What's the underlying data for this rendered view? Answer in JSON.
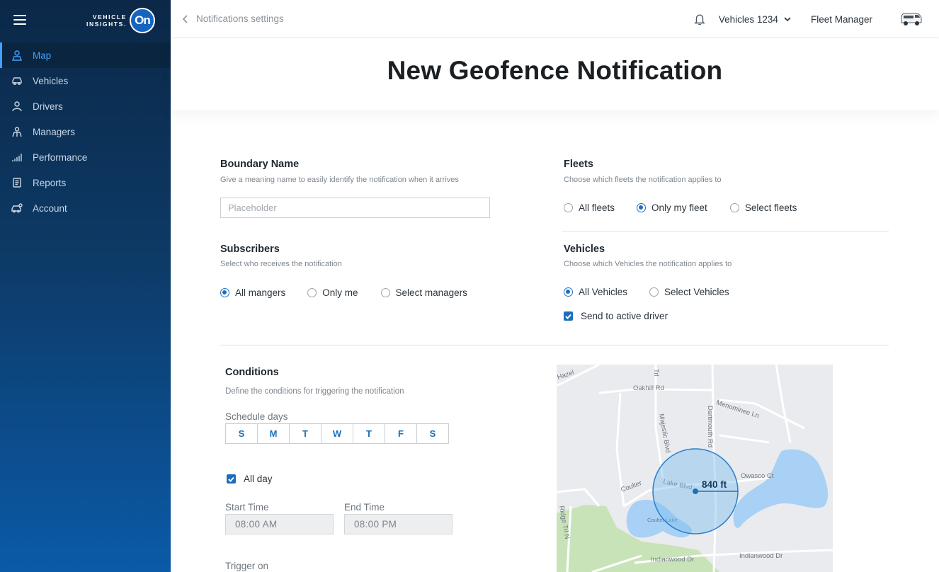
{
  "app": {
    "brand_line1": "VEHICLE",
    "brand_line2": "INSIGHTS.",
    "brand_mark": "On"
  },
  "sidebar": {
    "items": [
      {
        "label": "Map",
        "icon": "map-pin-user-icon",
        "active": true
      },
      {
        "label": "Vehicles",
        "icon": "car-icon",
        "active": false
      },
      {
        "label": "Drivers",
        "icon": "driver-icon",
        "active": false
      },
      {
        "label": "Managers",
        "icon": "managers-icon",
        "active": false
      },
      {
        "label": "Performance",
        "icon": "bar-chart-icon",
        "active": false
      },
      {
        "label": "Reports",
        "icon": "document-icon",
        "active": false
      },
      {
        "label": "Account",
        "icon": "account-car-icon",
        "active": false
      }
    ]
  },
  "topbar": {
    "back_label": "Notifications settings",
    "vehicles_label": "Vehicles 1234",
    "user_label": "Fleet Manager"
  },
  "page": {
    "title": "New Geofence Notification"
  },
  "boundary": {
    "title": "Boundary Name",
    "subtitle": "Give a meaning name to easily identify the notification when it arrives",
    "placeholder": "Placeholder",
    "value": ""
  },
  "fleets": {
    "title": "Fleets",
    "subtitle": "Choose which fleets the notification applies to",
    "options": [
      "All fleets",
      "Only my fleet",
      "Select fleets"
    ],
    "selected": "Only my fleet"
  },
  "subscribers": {
    "title": "Subscribers",
    "subtitle": "Select who receives the notification",
    "options": [
      "All mangers",
      "Only me",
      "Select managers"
    ],
    "selected": "All mangers"
  },
  "vehicles": {
    "title": "Vehicles",
    "subtitle": "Choose which Vehicles the notification applies to",
    "options": [
      "All Vehicles",
      "Select Vehicles"
    ],
    "selected": "All Vehicles",
    "send_active_driver_label": "Send to active driver",
    "send_active_driver_checked": true
  },
  "conditions": {
    "title": "Conditions",
    "subtitle": "Define the conditions for triggering the notification",
    "schedule_label": "Schedule days",
    "days": [
      "S",
      "M",
      "T",
      "W",
      "T",
      "F",
      "S"
    ],
    "all_day_label": "All day",
    "all_day_checked": true,
    "start_label": "Start Time",
    "start_value": "08:00 AM",
    "end_label": "End Time",
    "end_value": "08:00 PM",
    "trigger_label": "Trigger on"
  },
  "map": {
    "radius_label": "840 ft",
    "streets": [
      "Hazel",
      "Oakhill Rd",
      "Menominee Ln",
      "Dartmouth Rd",
      "Majestic Blvd",
      "Lake Blvd",
      "Owasco Ct",
      "Coulter",
      "Ridge Trl N",
      "Indianwood Dr",
      "Coulter Lake",
      "Trl"
    ],
    "colors": {
      "water": "#a9d0f5",
      "park": "#c9e3b9",
      "geofence": "#1d6fbd",
      "background": "#e9ebee"
    }
  },
  "colors": {
    "accent": "#1d6fbd",
    "sidebar_active": "#3fa2ff"
  }
}
